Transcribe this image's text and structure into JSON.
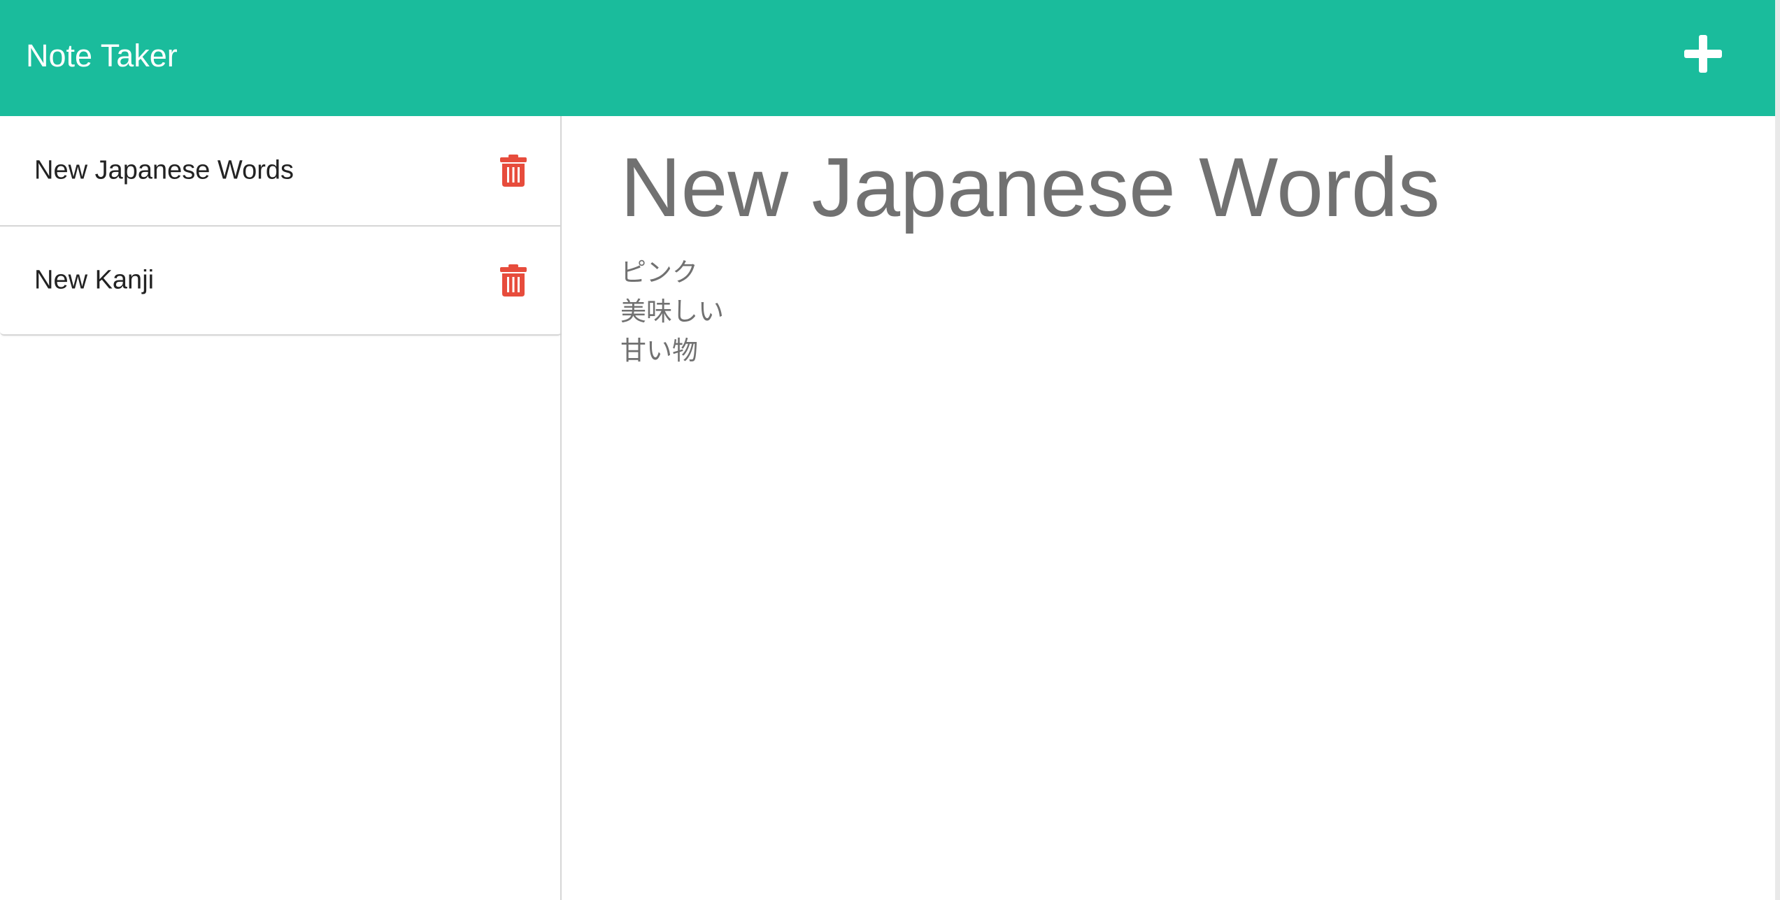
{
  "app": {
    "brand": "Note Taker",
    "accent_color": "#1abc9c",
    "delete_color": "#e74c3c",
    "new_note_icon": "plus-icon",
    "delete_icon": "trash-icon"
  },
  "sidebar": {
    "notes": [
      {
        "title": "New Japanese Words"
      },
      {
        "title": "New Kanji"
      }
    ]
  },
  "main": {
    "title": "New Japanese Words",
    "body_lines": [
      "ピンク",
      "美味しい",
      "甘い物"
    ]
  }
}
